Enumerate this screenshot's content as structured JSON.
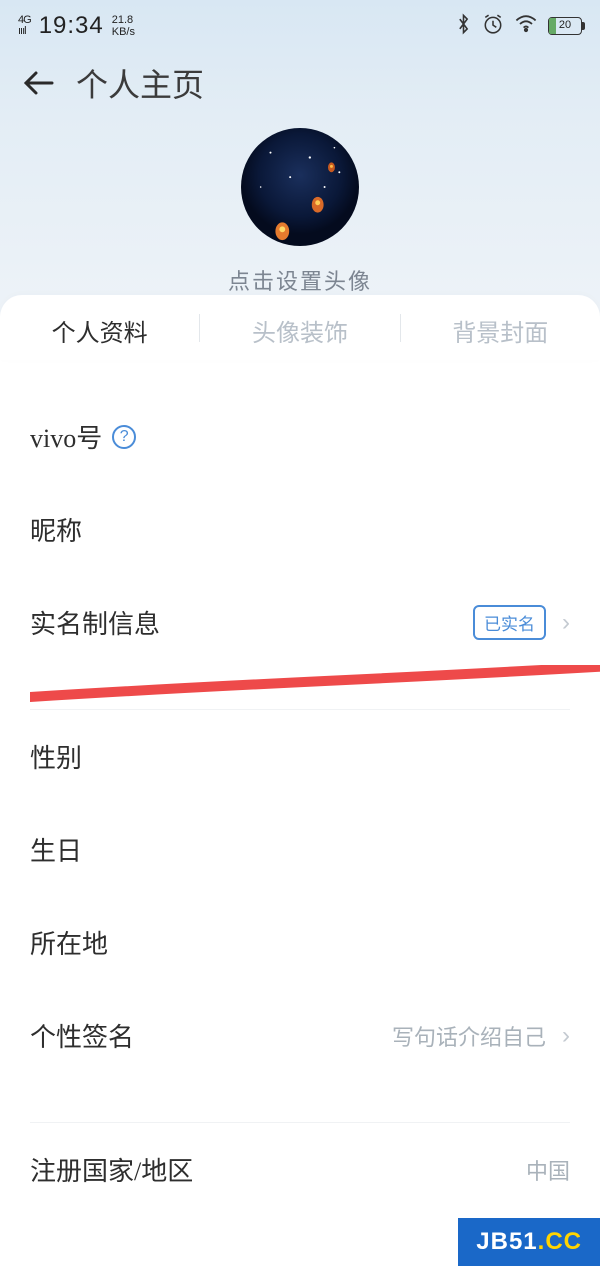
{
  "statusBar": {
    "network": "4G",
    "time": "19:34",
    "speed": "21.8",
    "speedUnit": "KB/s",
    "batteryPct": "20"
  },
  "nav": {
    "title": "个人主页"
  },
  "avatar": {
    "hint": "点击设置头像"
  },
  "tabs": [
    {
      "label": "个人资料",
      "active": true
    },
    {
      "label": "头像装饰",
      "active": false
    },
    {
      "label": "背景封面",
      "active": false
    }
  ],
  "fields": {
    "vivoId": {
      "label": "vivo号",
      "value": ""
    },
    "nickname": {
      "label": "昵称",
      "value": ""
    },
    "realName": {
      "label": "实名制信息",
      "badge": "已实名"
    },
    "gender": {
      "label": "性别",
      "value": ""
    },
    "birthday": {
      "label": "生日",
      "value": ""
    },
    "location": {
      "label": "所在地",
      "value": ""
    },
    "signature": {
      "label": "个性签名",
      "placeholder": "写句话介绍自己"
    },
    "region": {
      "label": "注册国家/地区",
      "value": "中国"
    }
  },
  "watermark": {
    "prefix": "JB51",
    "suffix": ".CC"
  }
}
